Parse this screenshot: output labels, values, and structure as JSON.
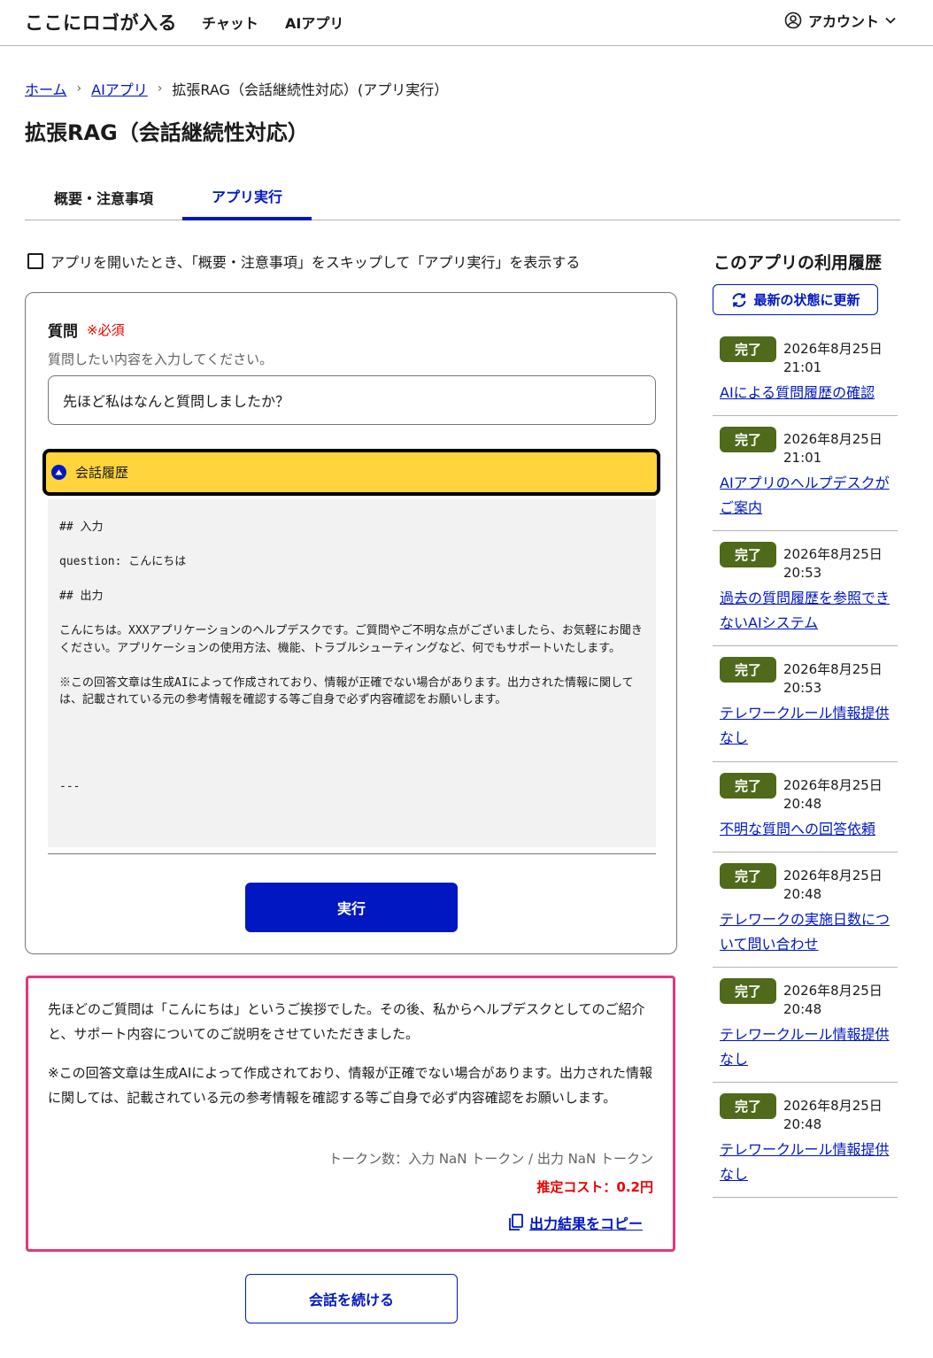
{
  "header": {
    "logo": "ここにロゴが入る",
    "nav": [
      "チャット",
      "AIアプリ"
    ],
    "account": "アカウント"
  },
  "breadcrumb": {
    "home": "ホーム",
    "apps": "AIアプリ",
    "current": "拡張RAG（会話継続性対応）(アプリ実行）"
  },
  "page_title": "拡張RAG（会話継続性対応）",
  "tabs": [
    {
      "label": "概要・注意事項",
      "active": false
    },
    {
      "label": "アプリ実行",
      "active": true
    }
  ],
  "skip_label": "アプリを開いたとき、「概要・注意事項」をスキップして「アプリ実行」を表示する",
  "form": {
    "question_label": "質問",
    "required": "※必須",
    "help": "質問したい内容を入力してください。",
    "question_value": "先ほど私はなんと質問しましたか？",
    "history_label": "会話履歴",
    "history_text": "## 入力\n\nquestion: こんにちは\n\n## 出力\n\nこんにちは。XXXアプリケーションのヘルプデスクです。ご質問やご不明な点がございましたら、お気軽にお聞きください。アプリケーションの使用方法、機能、トラブルシューティングなど、何でもサポートいたします。\n\n※この回答文章は生成AIによって作成されており、情報が正確でない場合があります。出力された情報に関しては、記載されている元の参考情報を確認する等ご自身で必ず内容確認をお願いします。\n\n\n\n\n---",
    "run_label": "実行"
  },
  "result": {
    "p1": "先ほどのご質問は「こんにちは」というご挨拶でした。その後、私からヘルプデスクとしてのご紹介と、サポート内容についてのご説明をさせていただきました。",
    "p2": "※この回答文章は生成AIによって作成されており、情報が正確でない場合があります。出力された情報に関しては、記載されている元の参考情報を確認する等ご自身で必ず内容確認をお願いします。",
    "tokens": "トークン数：入力 NaN トークン / 出力 NaN トークン",
    "cost": "推定コスト：0.2円",
    "copy_label": "出力結果をコピー"
  },
  "continue_label": "会話を続ける",
  "sidebar": {
    "title": "このアプリの利用履歴",
    "refresh_label": "最新の状態に更新",
    "items": [
      {
        "status": "完了",
        "date": "2026年8月25日",
        "time": "21:01",
        "title": "AIによる質問履歴の確認"
      },
      {
        "status": "完了",
        "date": "2026年8月25日",
        "time": "21:01",
        "title": "AIアプリのヘルプデスクがご案内"
      },
      {
        "status": "完了",
        "date": "2026年8月25日",
        "time": "20:53",
        "title": "過去の質問履歴を参照できないAIシステム"
      },
      {
        "status": "完了",
        "date": "2026年8月25日",
        "time": "20:53",
        "title": "テレワークルール情報提供なし"
      },
      {
        "status": "完了",
        "date": "2026年8月25日",
        "time": "20:48",
        "title": "不明な質問への回答依頼"
      },
      {
        "status": "完了",
        "date": "2026年8月25日",
        "time": "20:48",
        "title": "テレワークの実施日数について問い合わせ"
      },
      {
        "status": "完了",
        "date": "2026年8月25日",
        "time": "20:48",
        "title": "テレワークルール情報提供なし"
      },
      {
        "status": "完了",
        "date": "2026年8月25日",
        "time": "20:48",
        "title": "テレワークルール情報提供なし"
      }
    ]
  },
  "colors": {
    "primary": "#0017c1",
    "required": "#ec0000",
    "accordion": "#ffd43d",
    "badge": "#4e6a1a",
    "result_border": "#e0387a"
  }
}
